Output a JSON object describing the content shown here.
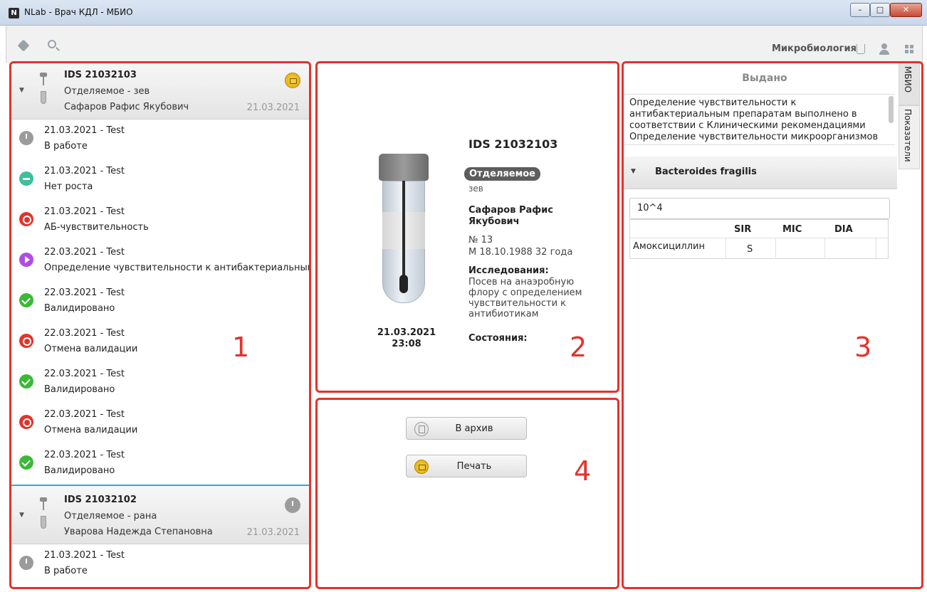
{
  "window": {
    "app_icon": "N",
    "title": "NLab - Врач КДЛ - МБИО",
    "controls": [
      "–",
      "□",
      "✕"
    ]
  },
  "toolbar": {
    "section": "Микробиология",
    "icons": [
      "tag-icon",
      "search-icon",
      "flask-icon",
      "user-icon",
      "grid-icon"
    ]
  },
  "annotations": [
    "1",
    "2",
    "3",
    "4"
  ],
  "left": {
    "card1": {
      "id": "IDS 21032103",
      "specimen": "Отделяемое  -  зев",
      "patient": "Сафаров Рафис Якубович",
      "date": "21.03.2021",
      "events": [
        {
          "icon": "clock",
          "line1": "21.03.2021 - Test",
          "line2": "В работе"
        },
        {
          "icon": "minus",
          "line1": "21.03.2021 - Test",
          "line2": "Нет роста"
        },
        {
          "icon": "cancel",
          "line1": "21.03.2021 - Test",
          "line2": "АБ-чувствительность"
        },
        {
          "icon": "play",
          "line1": "22.03.2021 - Test",
          "line2": "Определение чувствительности к антибактериальным п"
        },
        {
          "icon": "check",
          "line1": "22.03.2021 - Test",
          "line2": "Валидировано"
        },
        {
          "icon": "cancel",
          "line1": "22.03.2021 - Test",
          "line2": "Отмена валидации"
        },
        {
          "icon": "check",
          "line1": "22.03.2021 - Test",
          "line2": "Валидировано"
        },
        {
          "icon": "cancel",
          "line1": "22.03.2021 - Test",
          "line2": "Отмена валидации"
        },
        {
          "icon": "check",
          "line1": "22.03.2021 - Test",
          "line2": "Валидировано"
        }
      ]
    },
    "card2": {
      "id": "IDS 21032102",
      "specimen": "Отделяемое  -  рана",
      "patient": "Уварова Надежда Степановна",
      "date": "21.03.2021",
      "events": [
        {
          "icon": "clock",
          "line1": "21.03.2021 - Test",
          "line2": "В работе"
        }
      ]
    }
  },
  "detail": {
    "id": "IDS 21032103",
    "badge": "Отделяемое",
    "site": "зев",
    "patient": "Сафаров Рафис Якубович",
    "number": "№ 13",
    "birth": "М  18.10.1988  32 года",
    "research_title": "Исследования:",
    "research": "Посев на анаэробную флору с определением чувствительности к антибиотикам",
    "state_title": "Состояния:",
    "date": "21.03.2021",
    "time": "23:08"
  },
  "actions": {
    "archive": "В архив",
    "print": "Печать"
  },
  "result": {
    "status": "Выдано",
    "notes": "Определение чувствительности к антибактериальным препаратам выполнено в соответствии с Клиническими рекомендациями Определение чувствительности микроорганизмов к",
    "organism": "Bacteroides fragilis",
    "quantity": "10^4",
    "columns": [
      "SIR",
      "MIC",
      "DIA"
    ],
    "rows": [
      {
        "drug": "Амоксициллин",
        "sir": "S",
        "mic": "",
        "dia": ""
      }
    ],
    "tabs": [
      "МБИО",
      "Показатели"
    ]
  },
  "colors": {
    "frame": "#e4322b",
    "accent_blue": "#3ba3d8",
    "check": "#3cb838",
    "cancel": "#e0352c",
    "play": "#b04de0",
    "minus": "#3dbf9a",
    "clock": "#9b9b9b"
  }
}
